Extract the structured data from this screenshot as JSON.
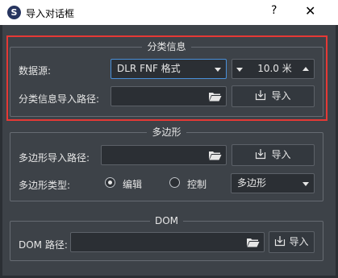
{
  "window": {
    "app_icon_letter": "S",
    "title": "导入对话框",
    "help_label": "?",
    "close_label": "✕"
  },
  "classification": {
    "title": "分类信息",
    "data_source_label": "数据源:",
    "data_source_value": "DLR FNF 格式",
    "resolution_value": "10.0 米",
    "path_label": "分类信息导入路径:",
    "path_value": "",
    "import_label": "导入"
  },
  "polygon": {
    "title": "多边形",
    "path_label": "多边形导入路径:",
    "path_value": "",
    "import_label": "导入",
    "type_label": "多边形类型:",
    "radio_edit_label": "编辑",
    "radio_control_label": "控制",
    "radio_selected": "编辑",
    "type_value": "多边形"
  },
  "dom": {
    "title": "DOM",
    "path_label": "DOM 路径:",
    "path_value": "",
    "import_label": "导入"
  },
  "colors": {
    "background": "#3d4248",
    "field": "#2b2f34",
    "highlight": "#e53935",
    "focus": "#4a90d9"
  },
  "icons": {
    "app": "app-logo-icon",
    "folder": "folder-open-icon",
    "import": "import-tray-icon"
  }
}
